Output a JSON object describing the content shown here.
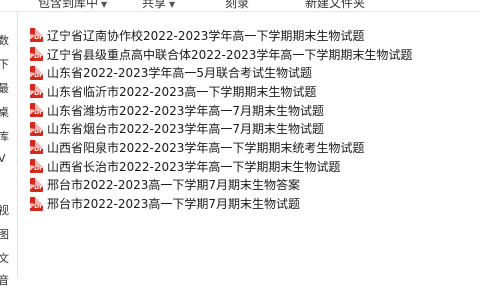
{
  "toolbar": {
    "include_library_label": "包含到库中",
    "share_label": "共享",
    "burn_label": "刻录",
    "new_folder_label": "新建文件夹"
  },
  "nav": {
    "items": [
      "数",
      "下",
      "最",
      "桌",
      "库",
      "V",
      "视",
      "图",
      "文",
      "音"
    ]
  },
  "file_icon_text": "PDF",
  "files": [
    {
      "name": "辽宁省辽南协作校2022-2023学年高一下学期期末生物试题"
    },
    {
      "name": "辽宁省县级重点高中联合体2022-2023学年高一下学期期末生物试题"
    },
    {
      "name": "山东省2022-2023学年高一5月联合考试生物试题"
    },
    {
      "name": "山东省临沂市2022-2023高一下学期期末生物试题"
    },
    {
      "name": "山东省潍坊市2022-2023学年高一7月期末生物试题"
    },
    {
      "name": "山东省烟台市2022-2023学年高一7月期末生物试题"
    },
    {
      "name": "山西省阳泉市2022-2023学年高一下学期期末统考生物试题"
    },
    {
      "name": "山西省长治市2022-2023学年高一下学期期末生物试题"
    },
    {
      "name": "邢台市2022-2023高一下学期7月期末生物答案"
    },
    {
      "name": "邢台市2022-2023高一下学期7月期末生物试题"
    }
  ]
}
